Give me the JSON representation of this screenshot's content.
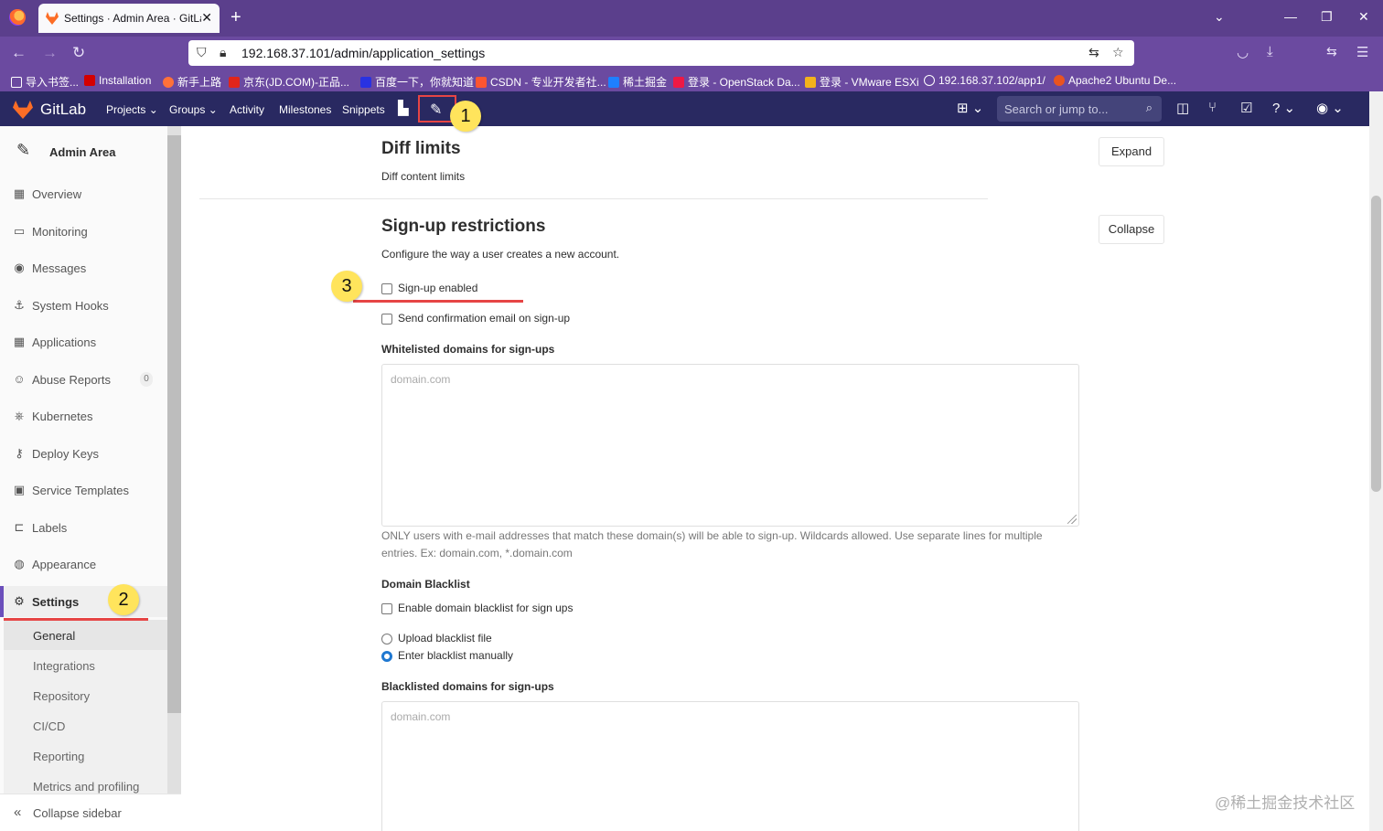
{
  "browser": {
    "tab_title": "Settings · Admin Area · GitLab",
    "url": "192.168.37.101/admin/application_settings",
    "bookmarks": [
      "导入书签...",
      "Installation",
      "新手上路",
      "京东(JD.COM)-正品...",
      "百度一下，你就知道",
      "CSDN - 专业开发者社...",
      "稀土掘金",
      "登录 - OpenStack Da...",
      "登录 - VMware ESXi",
      "192.168.37.102/app1/",
      "Apache2 Ubuntu De..."
    ],
    "colors": {
      "frame": "#5b3f8c",
      "toolbar": "#6b4aa0"
    }
  },
  "gitlab_header": {
    "brand": "GitLab",
    "nav": [
      "Projects",
      "Groups",
      "Activity",
      "Milestones",
      "Snippets"
    ],
    "search_placeholder": "Search or jump to...",
    "color": "#292961"
  },
  "callouts": [
    "1",
    "2",
    "3"
  ],
  "sidebar": {
    "title": "Admin Area",
    "items": [
      {
        "label": "Overview",
        "icon": "overview-icon"
      },
      {
        "label": "Monitoring",
        "icon": "monitor-icon"
      },
      {
        "label": "Messages",
        "icon": "broadcast-icon"
      },
      {
        "label": "System Hooks",
        "icon": "hook-icon"
      },
      {
        "label": "Applications",
        "icon": "grid-icon"
      },
      {
        "label": "Abuse Reports",
        "icon": "abuse-icon",
        "badge": "0"
      },
      {
        "label": "Kubernetes",
        "icon": "kubernetes-icon"
      },
      {
        "label": "Deploy Keys",
        "icon": "key-icon"
      },
      {
        "label": "Service Templates",
        "icon": "template-icon"
      },
      {
        "label": "Labels",
        "icon": "label-icon"
      },
      {
        "label": "Appearance",
        "icon": "appearance-icon"
      },
      {
        "label": "Settings",
        "icon": "gear-icon"
      }
    ],
    "settings_subitems": [
      "General",
      "Integrations",
      "Repository",
      "CI/CD",
      "Reporting",
      "Metrics and profiling"
    ],
    "collapse_label": "Collapse sidebar",
    "accent": "#6b4fbb"
  },
  "main": {
    "diff": {
      "title": "Diff limits",
      "desc": "Diff content limits",
      "button": "Expand"
    },
    "signup": {
      "title": "Sign-up restrictions",
      "desc": "Configure the way a user creates a new account.",
      "button": "Collapse",
      "signup_enabled": "Sign-up enabled",
      "send_confirmation": "Send confirmation email on sign-up",
      "whitelist_label": "Whitelisted domains for sign-ups",
      "whitelist_placeholder": "domain.com",
      "whitelist_help": "ONLY users with e-mail addresses that match these domain(s) will be able to sign-up. Wildcards allowed. Use separate lines for multiple entries. Ex: domain.com, *.domain.com",
      "blacklist_heading": "Domain Blacklist",
      "enable_blacklist": "Enable domain blacklist for sign ups",
      "upload_blacklist": "Upload blacklist file",
      "enter_blacklist": "Enter blacklist manually",
      "blacklist_label": "Blacklisted domains for sign-ups",
      "blacklist_placeholder": "domain.com"
    }
  },
  "watermark": "@稀土掘金技术社区"
}
